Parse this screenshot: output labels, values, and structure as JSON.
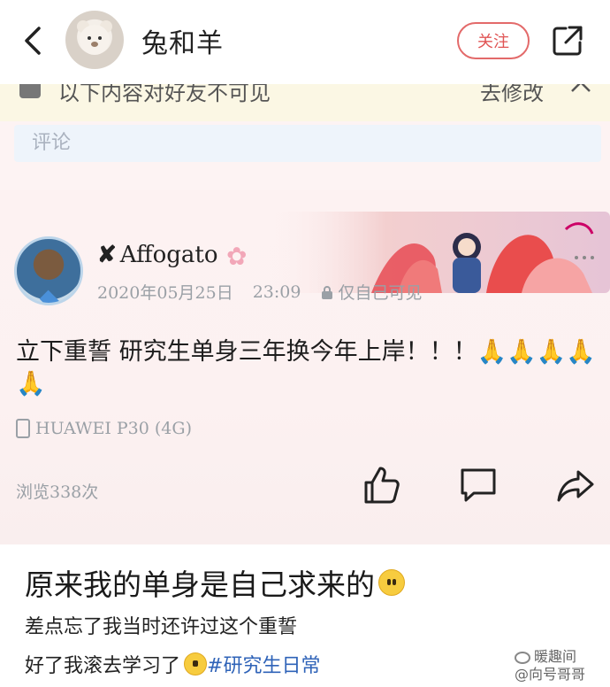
{
  "header": {
    "title": "兔和羊",
    "follow_label": "关注"
  },
  "notice": {
    "text": "以下内容对好友不可见",
    "action": "去修改"
  },
  "comment": {
    "placeholder": "评论"
  },
  "post": {
    "username": "Affogato",
    "date": "2020年05月25日",
    "time": "23:09",
    "visibility": "仅自己可见",
    "text": "立下重誓 研究生单身三年换今年上岸！！！🙏🙏🙏🙏🙏",
    "device": "HUAWEI P30 (4G)",
    "views": "浏览338次"
  },
  "caption": {
    "title": "原来我的单身是自己求来的",
    "line1": "差点忘了我当时还许过这个重誓",
    "line2_prefix": "好了我滚去学习了",
    "line2_hashtag": "#研究生日常"
  },
  "watermark": {
    "line1": "暖趣间",
    "line2": "@向号哥哥"
  },
  "colors": {
    "follow_border": "#e36a6a",
    "hashtag": "#2f63b8",
    "card_bg": "#fdf2f2",
    "notice_bg": "#fbf7e4"
  },
  "icons": [
    "back-arrow-icon",
    "share-external-icon",
    "lock-icon",
    "chevron-up-icon",
    "sakura-icon",
    "phone-icon",
    "thumbs-up-icon",
    "comment-icon",
    "forward-icon",
    "weibo-icon"
  ]
}
